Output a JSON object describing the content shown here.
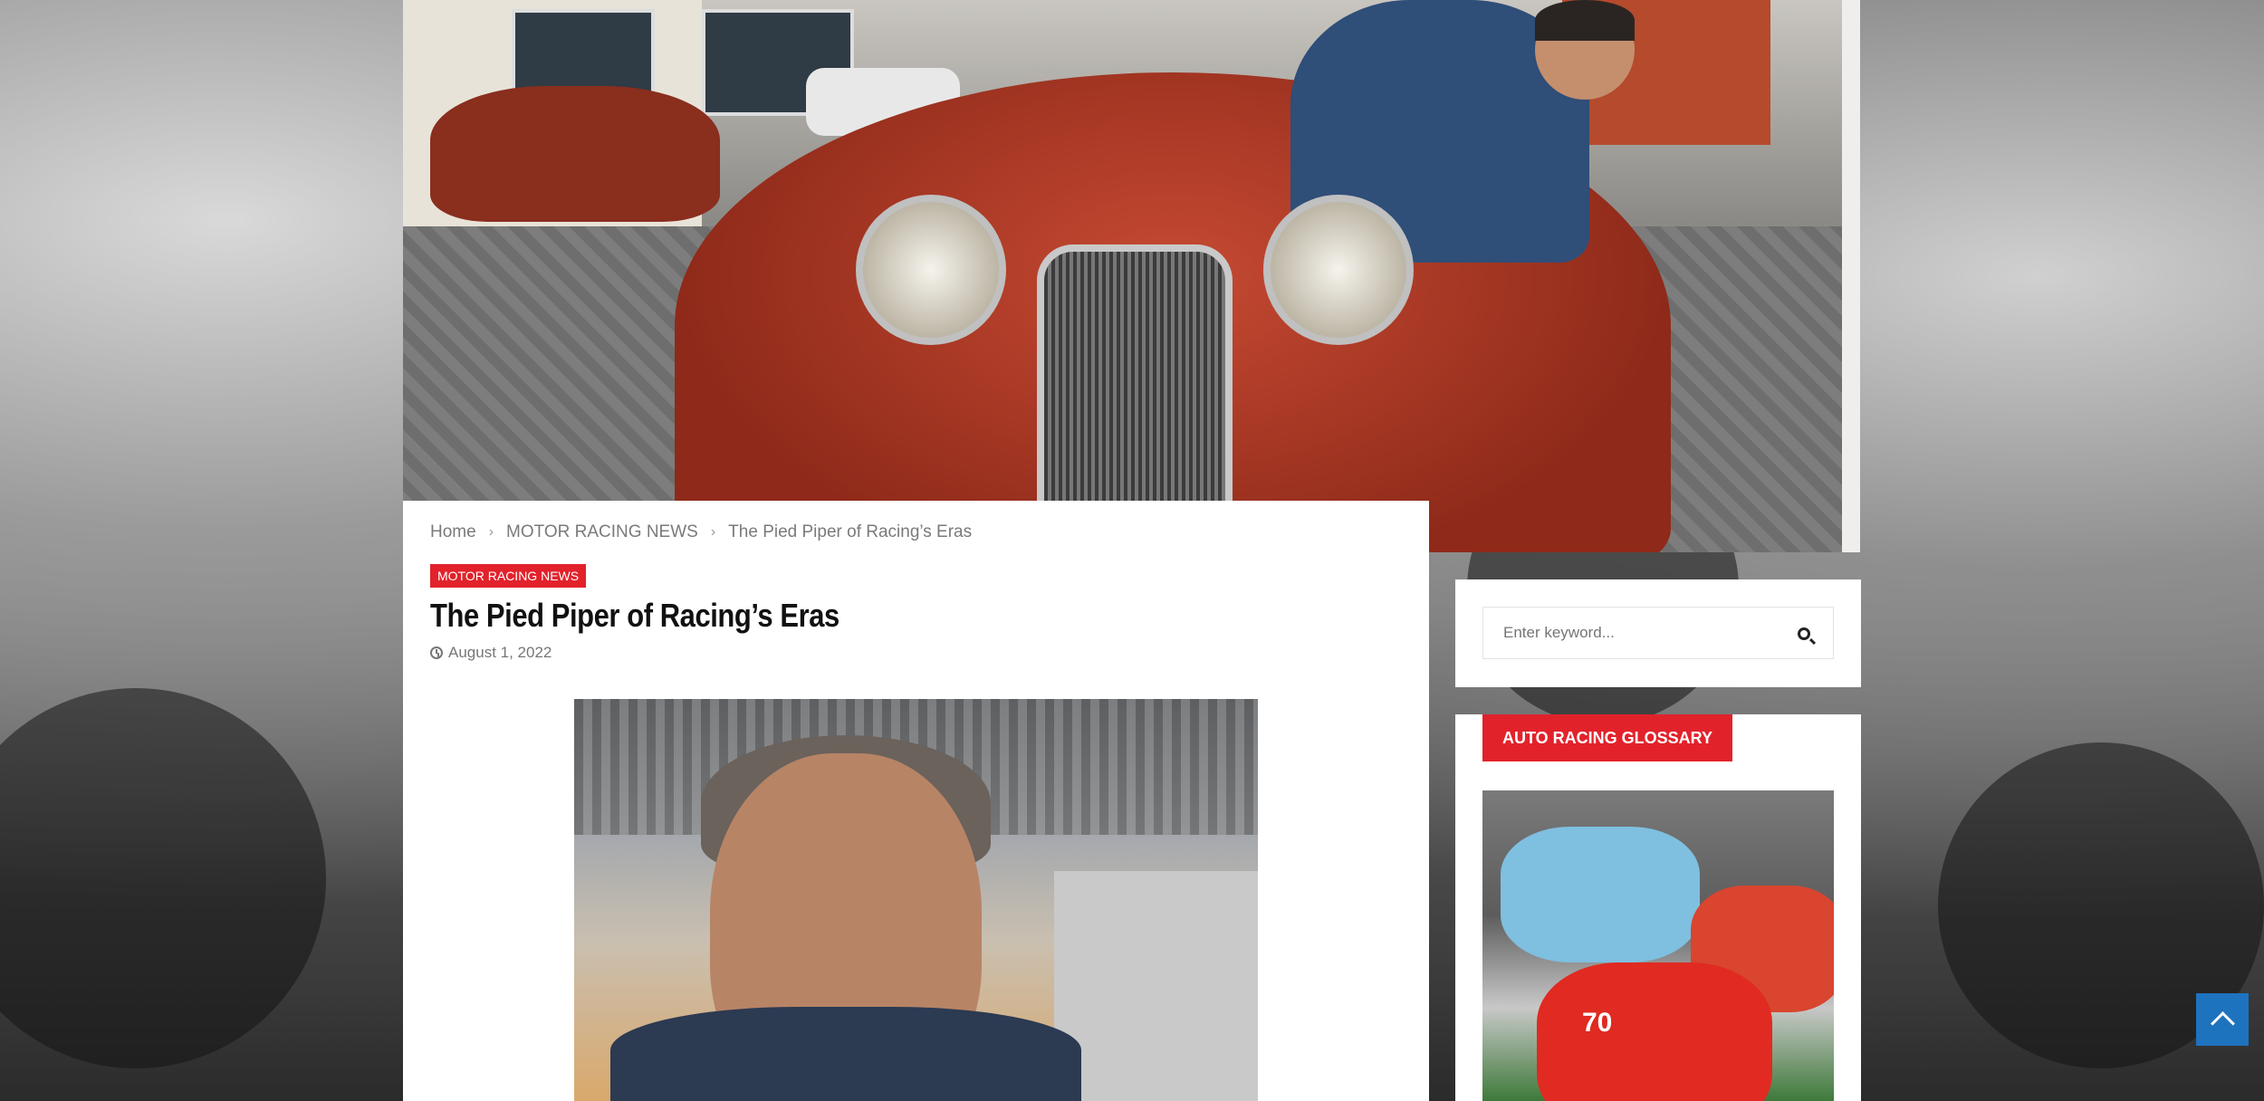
{
  "breadcrumb": {
    "home": "Home",
    "category": "MOTOR RACING NEWS",
    "current": "The Pied Piper of Racing’s Eras"
  },
  "post": {
    "category_badge": "MOTOR RACING NEWS",
    "title": "The Pied Piper of Racing’s Eras",
    "date": "August 1, 2022"
  },
  "search": {
    "placeholder": "Enter keyword..."
  },
  "sidebar": {
    "widget_title": "AUTO RACING GLOSSARY",
    "car_number": "70"
  },
  "colors": {
    "accent": "#e2222b",
    "back_to_top": "#1e73be"
  },
  "icons": [
    "breadcrumb-chevron-icon",
    "clock-icon",
    "search-icon",
    "chevron-up-icon"
  ]
}
